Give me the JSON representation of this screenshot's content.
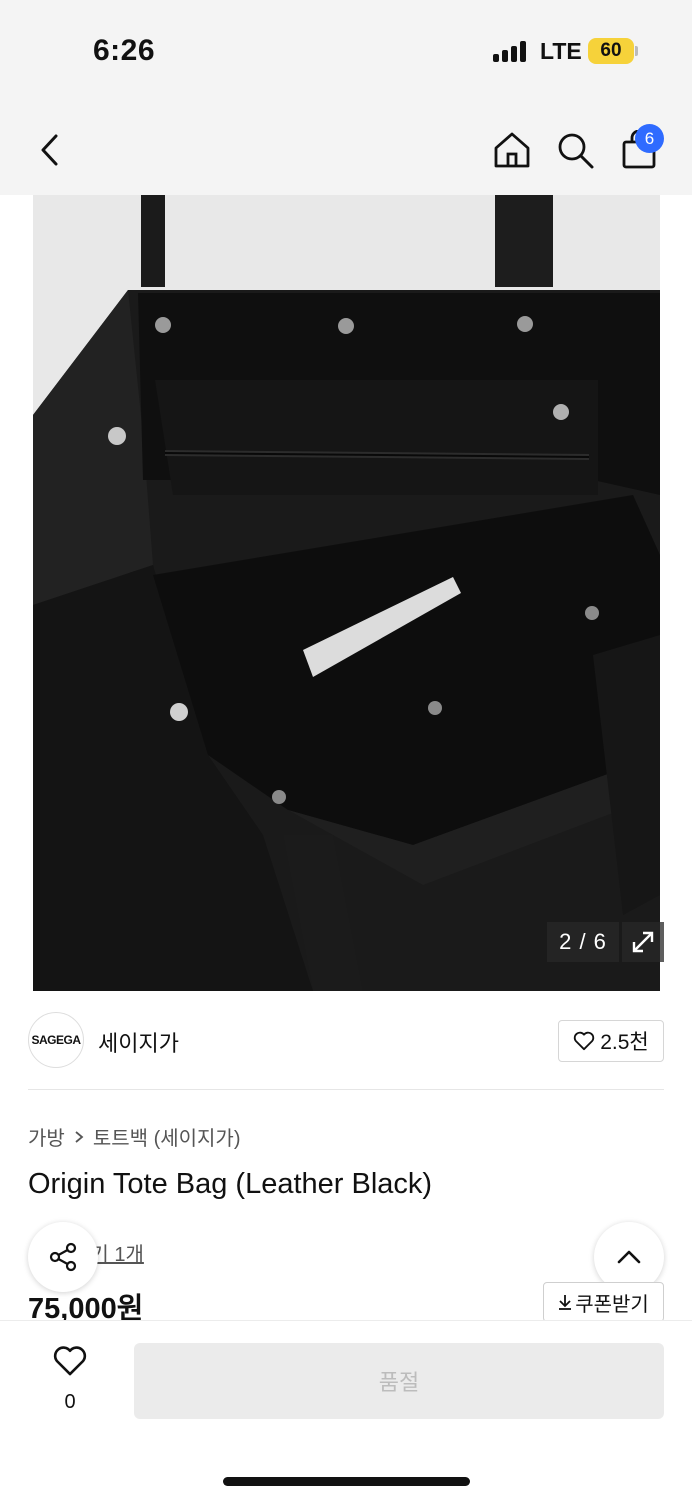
{
  "status_bar": {
    "time": "6:26",
    "network": "LTE",
    "battery": "60",
    "battery_color": "#f6d23a"
  },
  "nav": {
    "back_icon": "chevron-left-icon",
    "home_icon": "home-icon",
    "search_icon": "search-icon",
    "cart_icon": "shopping-bag-icon",
    "cart_count": "6",
    "badge_color": "#2f6bff"
  },
  "gallery": {
    "counter": "2 / 6",
    "expand_icon": "expand-icon"
  },
  "brand": {
    "logo_text": "SAGEGA",
    "name": "세이지가",
    "like_count": "2.5천"
  },
  "product": {
    "breadcrumb": [
      "가방",
      "토트백 (세이지가)"
    ],
    "title": "Origin Tote Bag (Leather Black)",
    "review_text": "후기 1개",
    "price": "75,000원",
    "coupon_label": "쿠폰받기"
  },
  "bottom_bar": {
    "wish_count": "0",
    "buy_label": "품절"
  }
}
